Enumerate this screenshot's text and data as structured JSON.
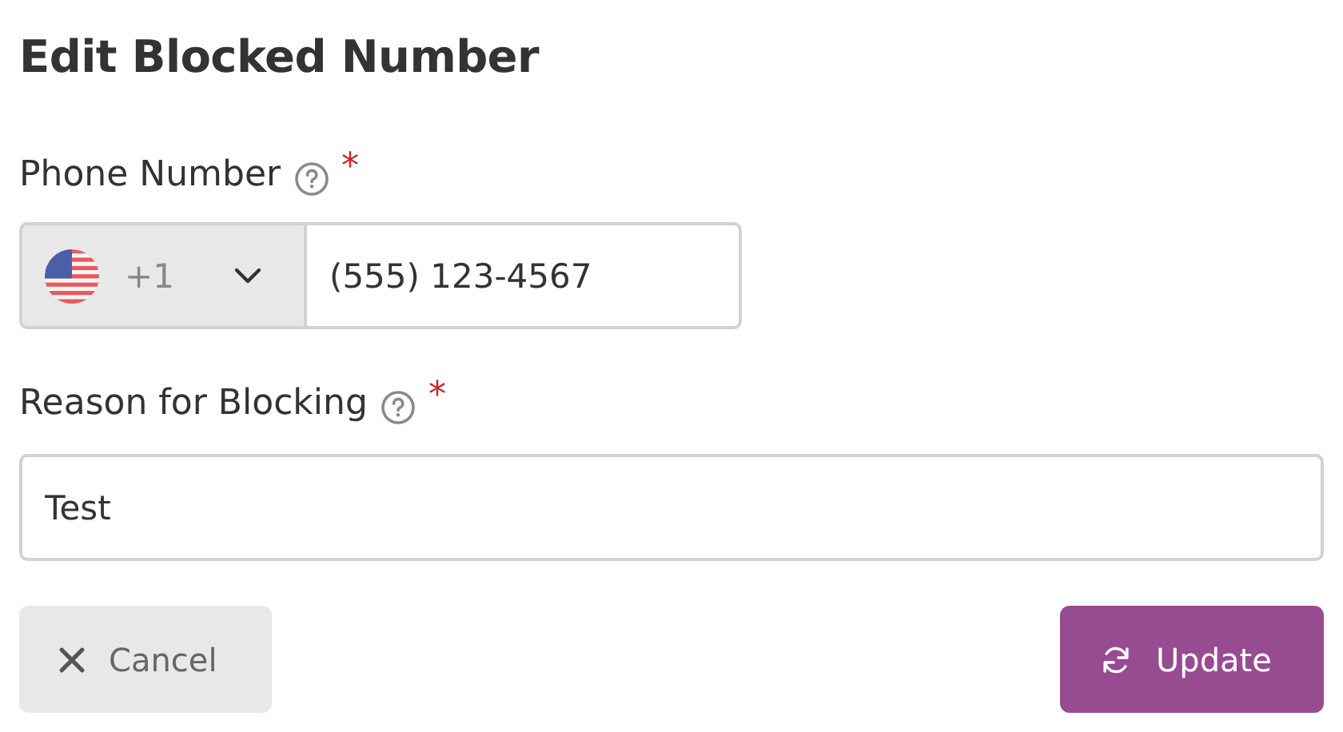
{
  "title": "Edit Blocked Number",
  "phone": {
    "label": "Phone Number",
    "required": true,
    "required_mark": "*",
    "country_code": "+1",
    "value": "(555) 123-4567"
  },
  "reason": {
    "label": "Reason for Blocking",
    "required": true,
    "required_mark": "*",
    "value": "Test"
  },
  "buttons": [
    {
      "kind": "cancel",
      "label": "Cancel"
    },
    {
      "kind": "update",
      "label": "Update"
    }
  ]
}
